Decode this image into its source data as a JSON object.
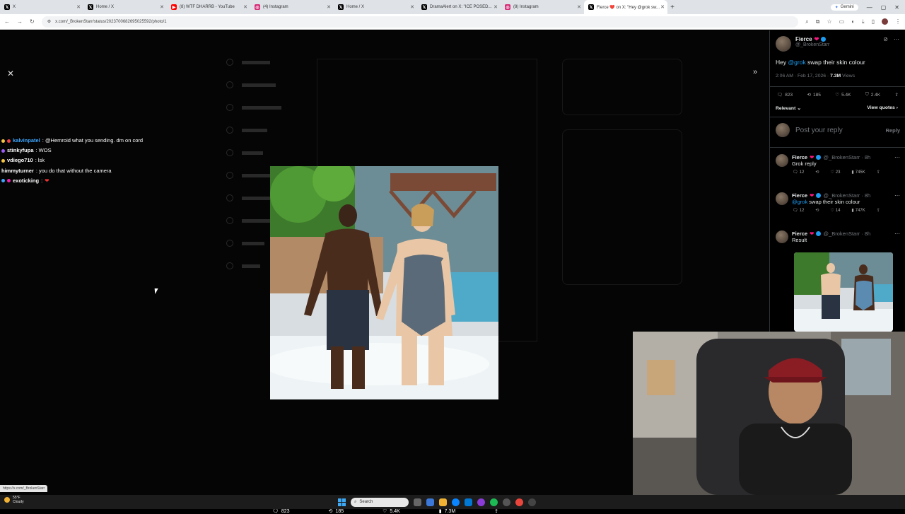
{
  "browser": {
    "tabs": [
      {
        "title": "X",
        "icon": "x-logo-icon",
        "active": false
      },
      {
        "title": "Home / X",
        "icon": "x-logo-icon",
        "active": false
      },
      {
        "title": "(8) WTF DHARRB - YouTube",
        "icon": "youtube-icon",
        "active": false
      },
      {
        "title": "(4) Instagram",
        "icon": "instagram-icon",
        "active": false
      },
      {
        "title": "Home / X",
        "icon": "x-logo-icon",
        "active": false
      },
      {
        "title": "DramaAlert on X: \"ICE POSED...",
        "icon": "x-logo-icon",
        "active": false
      },
      {
        "title": "(8) Instagram",
        "icon": "instagram-icon",
        "active": false
      },
      {
        "title": "Fierce ❤️ on X: \"Hey @grok sw...",
        "icon": "x-logo-icon",
        "active": true
      }
    ],
    "gemini_label": "Gemini",
    "url": "x.com/_BrokenStarr/status/2023700682695025592/photo/1"
  },
  "chat": [
    {
      "user": "kalvinpatel",
      "message": ": @Hemroid what you sending. dm on cord",
      "color": "#3ea6ff"
    },
    {
      "user": "stinkyfupa",
      "message": ": WOS",
      "color": "#ffffff"
    },
    {
      "user": "vdiego710",
      "message": ": lsk",
      "color": "#ffffff"
    },
    {
      "user": "himmyturner",
      "message": ": you do that without the camera",
      "color": "#ffffff"
    },
    {
      "user": "exoticking",
      "message": ": ",
      "color": "#ffffff"
    }
  ],
  "viewer": {
    "close_icon": "close-icon",
    "expand_icon": "double-chevron-right-icon",
    "actions": {
      "replies": "823",
      "reposts": "185",
      "likes": "5.4K",
      "views": "7.3M"
    }
  },
  "status_url": "https://x.com/_BrokenStarr",
  "post": {
    "name": "Fierce",
    "handle": "@_BrokenStarr",
    "text_prefix": "Hey ",
    "mention": "@grok",
    "text_suffix": " swap their skin colour",
    "time": "2:06 AM · Feb 17, 2026 · ",
    "views": "7.3M",
    "views_label": " Views",
    "stats": {
      "replies": "823",
      "reposts": "185",
      "likes": "5.4K",
      "bookmarks": "2.4K"
    },
    "relevant_label": "Relevant",
    "view_quotes_label": "View quotes",
    "compose_placeholder": "Post your reply",
    "reply_button": "Reply"
  },
  "replies": [
    {
      "name": "Fierce",
      "handle": "@_BrokenStarr · 8h",
      "text": "Grok reply",
      "mention": "",
      "stats": {
        "replies": "12",
        "reposts": "",
        "likes": "23",
        "views": "745K"
      }
    },
    {
      "name": "Fierce",
      "handle": "@_BrokenStarr · 8h",
      "text": " swap their skin colour",
      "mention": "@grok",
      "stats": {
        "replies": "12",
        "reposts": "",
        "likes": "14",
        "views": "747K"
      }
    },
    {
      "name": "Fierce",
      "handle": "@_BrokenStarr · 8h",
      "text": "Result",
      "mention": "",
      "stats": {}
    }
  ],
  "taskbar": {
    "weather_temp": "55°F",
    "weather_desc": "Cloudy",
    "search_placeholder": "Search"
  },
  "colors": {
    "accent": "#1d9bf0",
    "like": "#f91880",
    "background": "#000000"
  }
}
